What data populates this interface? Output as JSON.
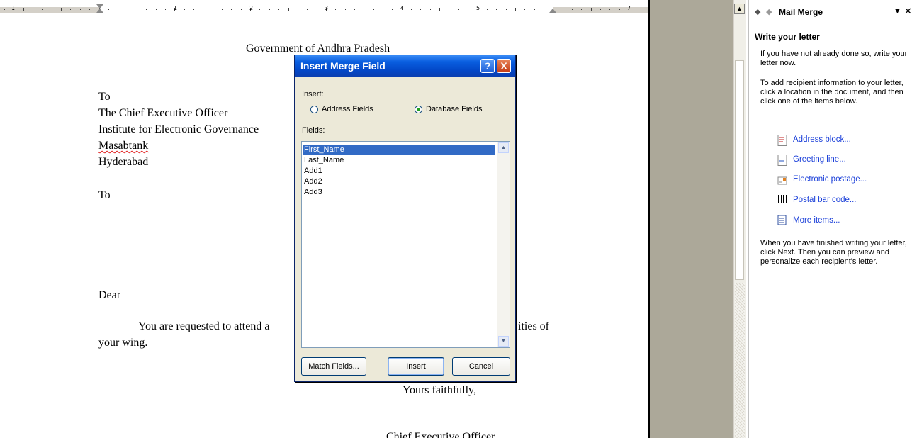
{
  "ruler": {
    "numbers": [
      "1",
      "1",
      "2",
      "3",
      "4",
      "5",
      "7"
    ]
  },
  "document": {
    "heading": "Government of Andhra Pradesh",
    "lines": [
      "To",
      "The Chief Executive Officer",
      "Institute for Electronic Governance",
      "Masabtank",
      "Hyderabad"
    ],
    "to2": "To",
    "dear": "Dear",
    "body_left": "You are requested to attend a",
    "body_right": "ities of",
    "body_line2": "your wing.",
    "closing": "Yours faithfully,",
    "signature_partial": "Chief Executive Officer"
  },
  "dialog": {
    "title": "Insert Merge Field",
    "help_glyph": "?",
    "close_glyph": "X",
    "insert_label": "Insert:",
    "radio_address": "Address Fields",
    "radio_database": "Database Fields",
    "selected_radio": "Database Fields",
    "fields_label": "Fields:",
    "fields": [
      "First_Name",
      "Last_Name",
      "Add1",
      "Add2",
      "Add3"
    ],
    "selected_field": "First_Name",
    "buttons": {
      "match": "Match Fields...",
      "insert": "Insert",
      "cancel": "Cancel"
    }
  },
  "taskpane": {
    "title": "Mail Merge",
    "section": "Write your letter",
    "intro": "If you have not already done so, write your letter now.",
    "instructions": "To add recipient information to your letter, click a location in the document, and then click one of the items below.",
    "links": [
      {
        "label": "Address block...",
        "icon": "address-block-icon"
      },
      {
        "label": "Greeting line...",
        "icon": "greeting-line-icon"
      },
      {
        "label": "Electronic postage...",
        "icon": "electronic-postage-icon"
      },
      {
        "label": "Postal bar code...",
        "icon": "postal-barcode-icon"
      },
      {
        "label": "More items...",
        "icon": "more-items-icon"
      }
    ],
    "finish": "When you have finished writing your letter, click Next. Then you can preview and personalize each recipient's letter."
  },
  "colors": {
    "link": "#1a3fd9",
    "selection": "#316ac5",
    "titlebar": "#0a5fe0"
  }
}
